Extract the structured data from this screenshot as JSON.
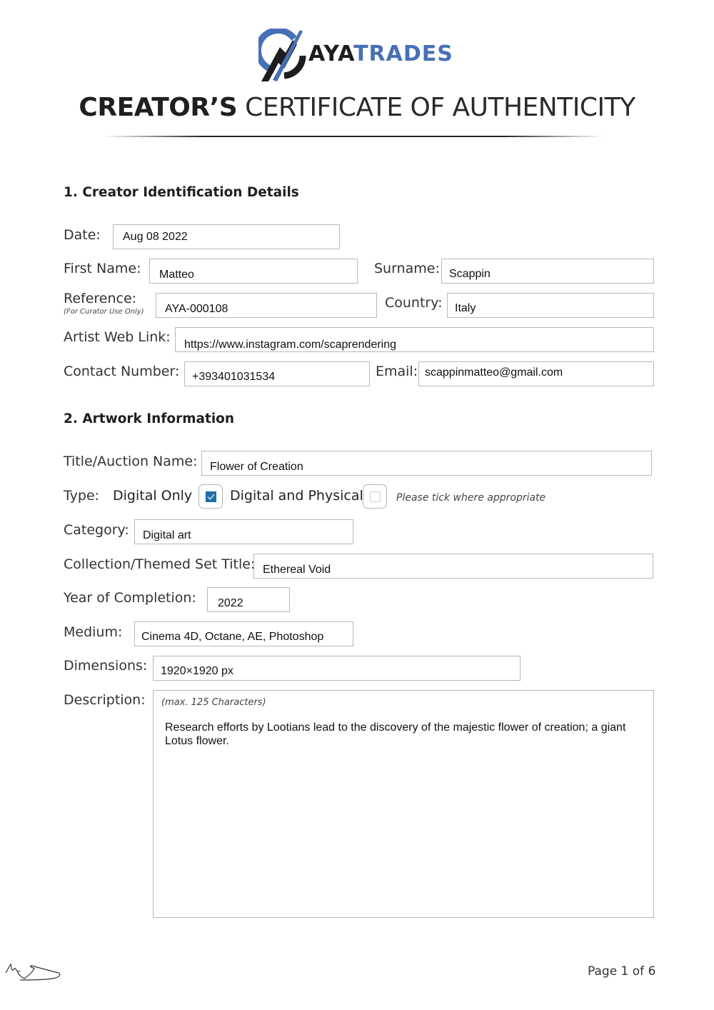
{
  "brand": {
    "part1": "AYA",
    "part2": "TRADES",
    "primary_color": "#1d1d1d",
    "accent_color": "#4770b6"
  },
  "header": {
    "title_bold": "CREATOR’S",
    "title_light": "CERTIFICATE OF AUTHENTICITY"
  },
  "section1": {
    "heading": "1. Creator Identification Details",
    "date": {
      "label": "Date:",
      "value": "Aug 08 2022"
    },
    "first_name": {
      "label": "First Name:",
      "value": "Matteo"
    },
    "surname": {
      "label": "Surname:",
      "value": "Scappin"
    },
    "reference": {
      "label": "Reference:",
      "sublabel": "(For Curator Use Only)",
      "value": "AYA-000108"
    },
    "country": {
      "label": "Country:",
      "value": "Italy"
    },
    "web_link": {
      "label": "Artist Web Link:",
      "value": "https://www.instagram.com/scaprendering"
    },
    "contact": {
      "label": "Contact Number:",
      "value": "+393401031534"
    },
    "email": {
      "label": "Email:",
      "value": "scappinmatteo@gmail.com"
    }
  },
  "section2": {
    "heading": "2. Artwork Information",
    "title": {
      "label": "Title/Auction Name:",
      "value": "Flower of Creation"
    },
    "type": {
      "label": "Type:",
      "options": [
        {
          "label": "Digital Only",
          "checked": true
        },
        {
          "label": "Digital and Physical",
          "checked": false
        }
      ],
      "hint": "Please tick where appropriate",
      "check_color": "#1f6fa6"
    },
    "category": {
      "label": "Category:",
      "value": "Digital art"
    },
    "collection": {
      "label": "Collection/Themed Set Title:",
      "value": "Ethereal Void"
    },
    "year": {
      "label": "Year of Completion:",
      "value": "2022"
    },
    "medium": {
      "label": "Medium:",
      "value": "Cinema 4D, Octane, AE, Photoshop"
    },
    "dimensions": {
      "label": "Dimensions:",
      "value": "1920×1920 px"
    },
    "description": {
      "label": "Description:",
      "hint": "(max. 125 Characters)",
      "value": "Research efforts by Lootians lead to the discovery of the majestic flower of creation; a giant Lotus flower."
    }
  },
  "footer": {
    "page": "Page 1 of 6"
  }
}
